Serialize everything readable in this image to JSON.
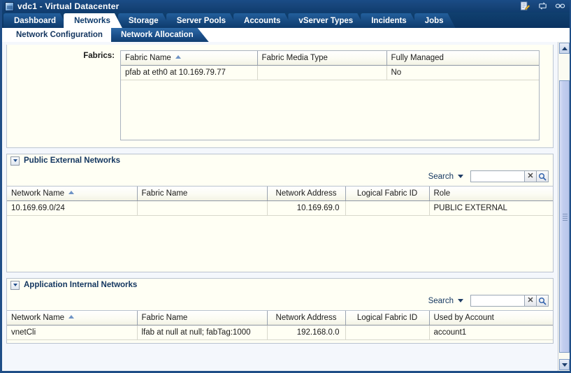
{
  "window": {
    "title": "vdc1 - Virtual Datacenter",
    "icons": [
      "edit-icon",
      "refresh-icon",
      "link-icon"
    ]
  },
  "main_tabs": [
    {
      "label": "Dashboard",
      "active": false
    },
    {
      "label": "Networks",
      "active": true
    },
    {
      "label": "Storage",
      "active": false
    },
    {
      "label": "Server Pools",
      "active": false
    },
    {
      "label": "Accounts",
      "active": false
    },
    {
      "label": "vServer Types",
      "active": false
    },
    {
      "label": "Incidents",
      "active": false
    },
    {
      "label": "Jobs",
      "active": false
    }
  ],
  "sub_tabs": [
    {
      "label": "Network Configuration",
      "active": true
    },
    {
      "label": "Network Allocation",
      "active": false
    }
  ],
  "fabrics": {
    "label": "Fabrics:",
    "columns": [
      "Fabric Name",
      "Fabric Media Type",
      "Fully Managed"
    ],
    "sorted_column": "Fabric Name",
    "sort_direction": "asc",
    "rows": [
      {
        "fabric_name": "pfab at eth0 at 10.169.79.77",
        "fabric_media_type": "",
        "fully_managed": "No"
      }
    ]
  },
  "public_external": {
    "title": "Public External Networks",
    "expanded": true,
    "search": {
      "label": "Search",
      "value": "",
      "placeholder": ""
    },
    "columns": [
      "Network Name",
      "Fabric Name",
      "Network Address",
      "Logical Fabric ID",
      "Role"
    ],
    "sorted_column": "Network Name",
    "sort_direction": "asc",
    "rows": [
      {
        "network_name": "10.169.69.0/24",
        "fabric_name": "",
        "network_address": "10.169.69.0",
        "logical_fabric_id": "",
        "role": "PUBLIC EXTERNAL"
      }
    ]
  },
  "application_internal": {
    "title": "Application Internal Networks",
    "expanded": true,
    "search": {
      "label": "Search",
      "value": "",
      "placeholder": ""
    },
    "columns": [
      "Network Name",
      "Fabric Name",
      "Network Address",
      "Logical Fabric ID",
      "Used by Account"
    ],
    "sorted_column": "Network Name",
    "sort_direction": "asc",
    "rows": [
      {
        "network_name": "vnetCli",
        "fabric_name": "lfab at null at null; fabTag:1000",
        "network_address": "192.168.0.0",
        "logical_fabric_id": "",
        "used_by_account": "account1"
      }
    ]
  },
  "colors": {
    "titlebar": "#123f72",
    "tab_active_bg": "#ffffff",
    "tab_active_text": "#0d3a6b",
    "table_bg": "#fffff4",
    "accent": "#1f4e87"
  }
}
